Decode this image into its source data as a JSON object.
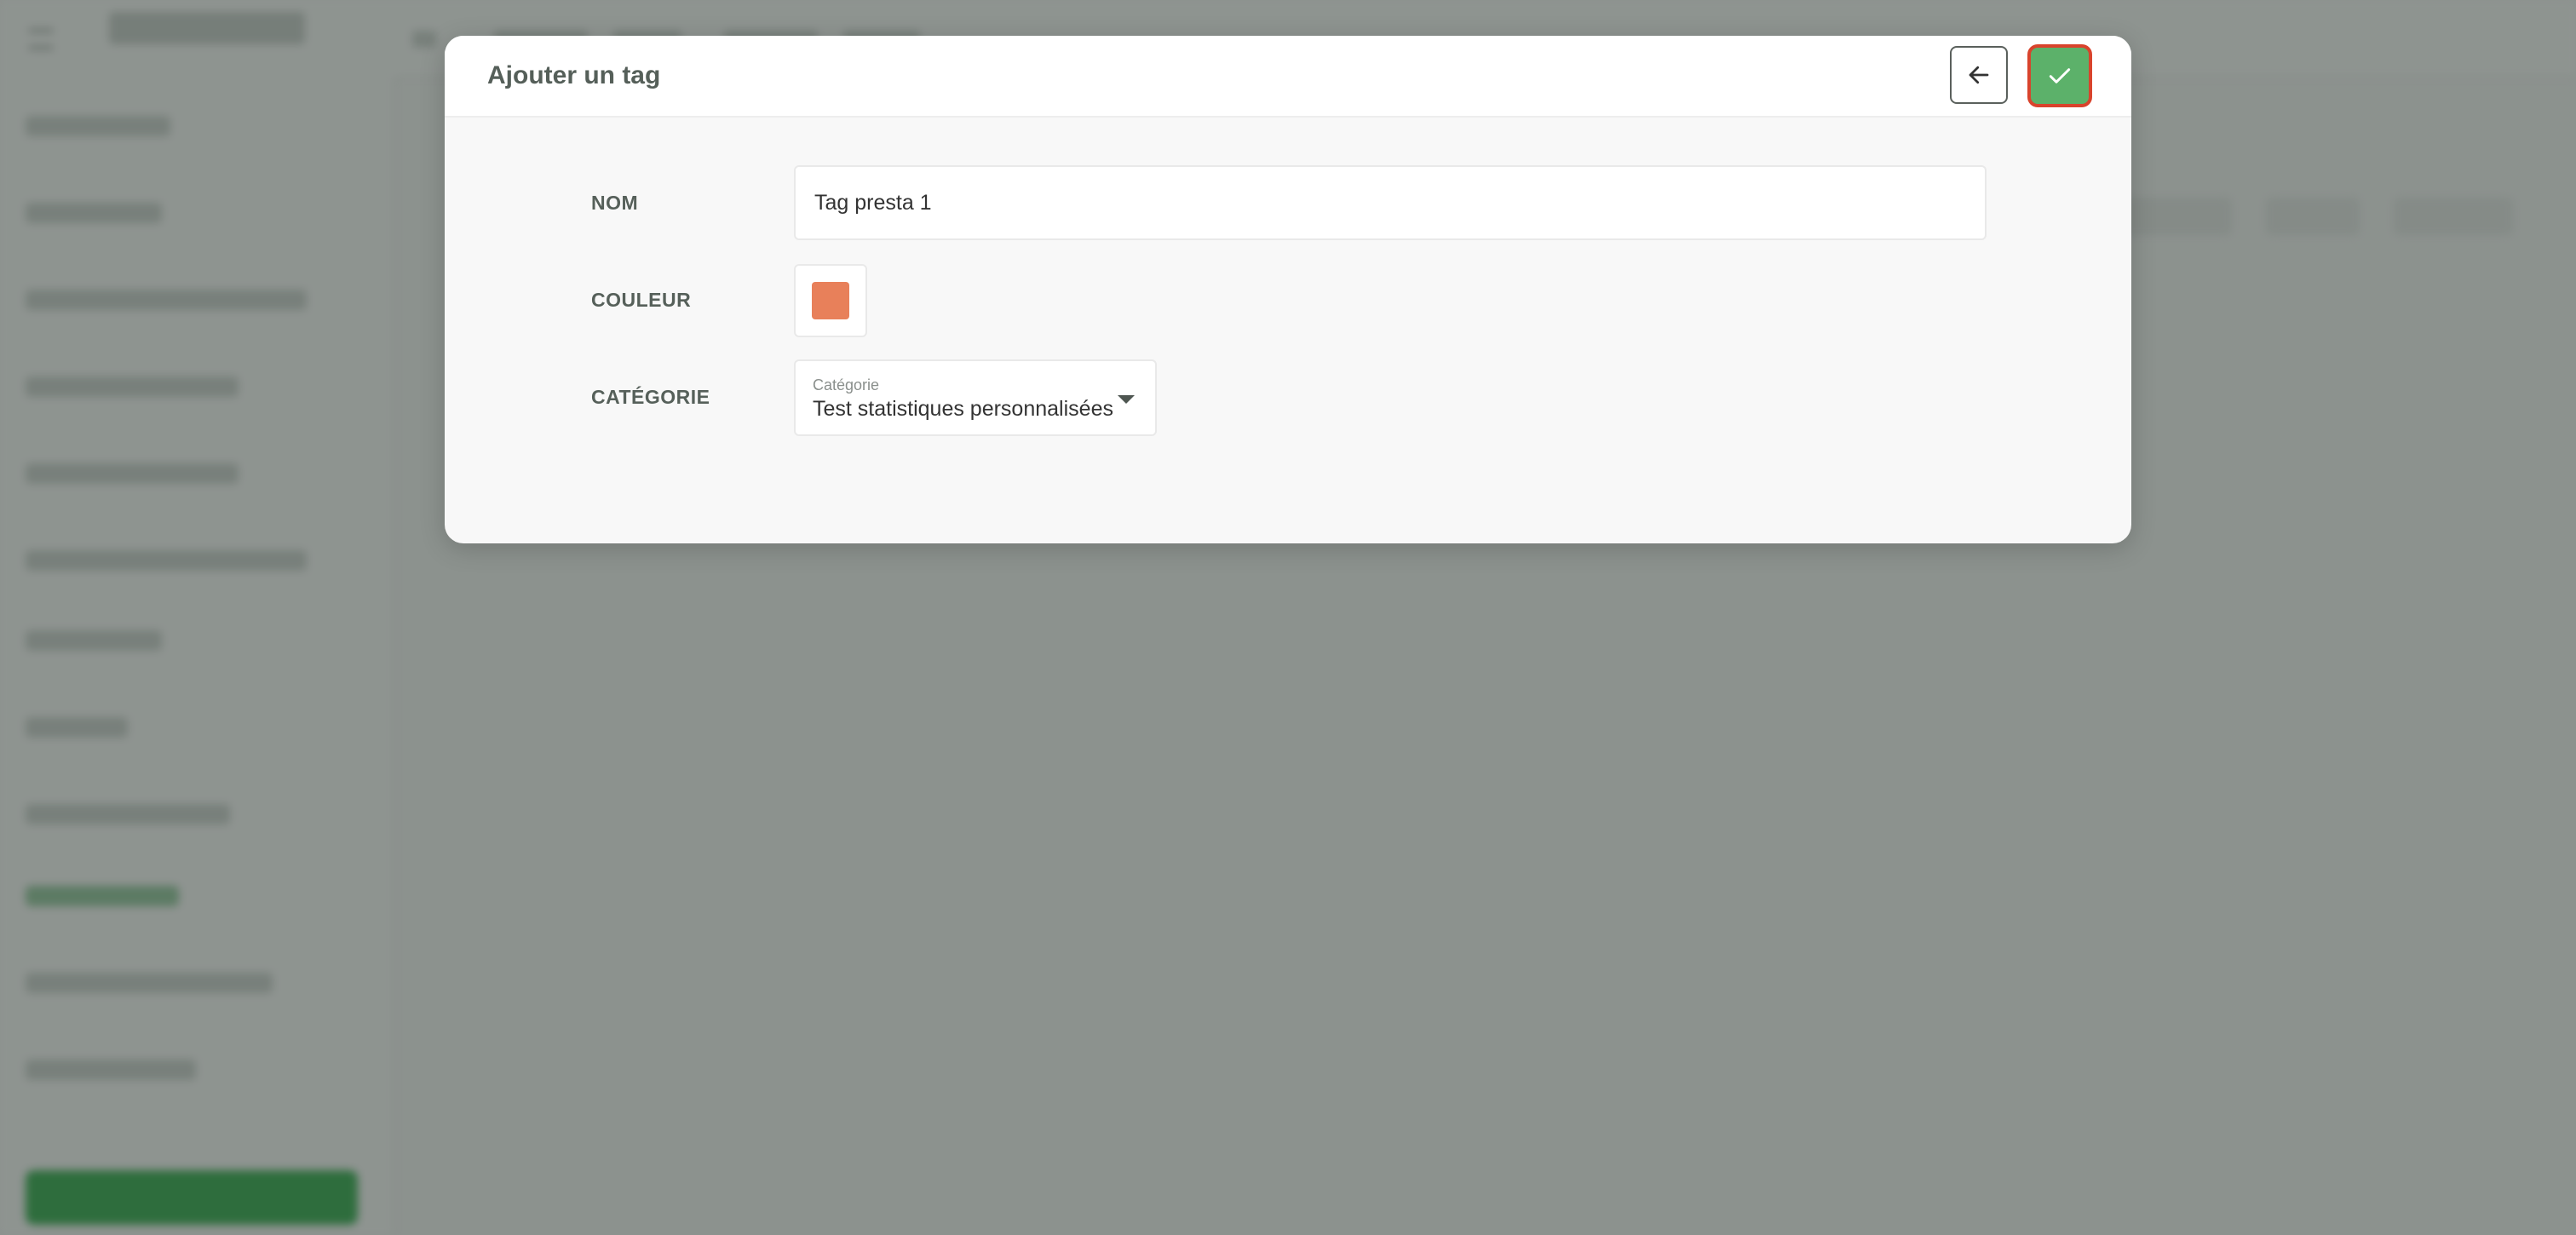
{
  "modal": {
    "title": "Ajouter un tag",
    "back_icon": "arrow-left-icon",
    "confirm_icon": "check-icon"
  },
  "form": {
    "name": {
      "label": "NOM",
      "value": "Tag presta 1"
    },
    "color": {
      "label": "COULEUR",
      "value": "#e8805a"
    },
    "category": {
      "label": "CATÉGORIE",
      "floating_label": "Catégorie",
      "selected": "Test statistiques personnalisées"
    }
  },
  "colors": {
    "confirm_button": "#5cb16a",
    "confirm_border": "#d9432c",
    "overlay": "#2e3832"
  }
}
